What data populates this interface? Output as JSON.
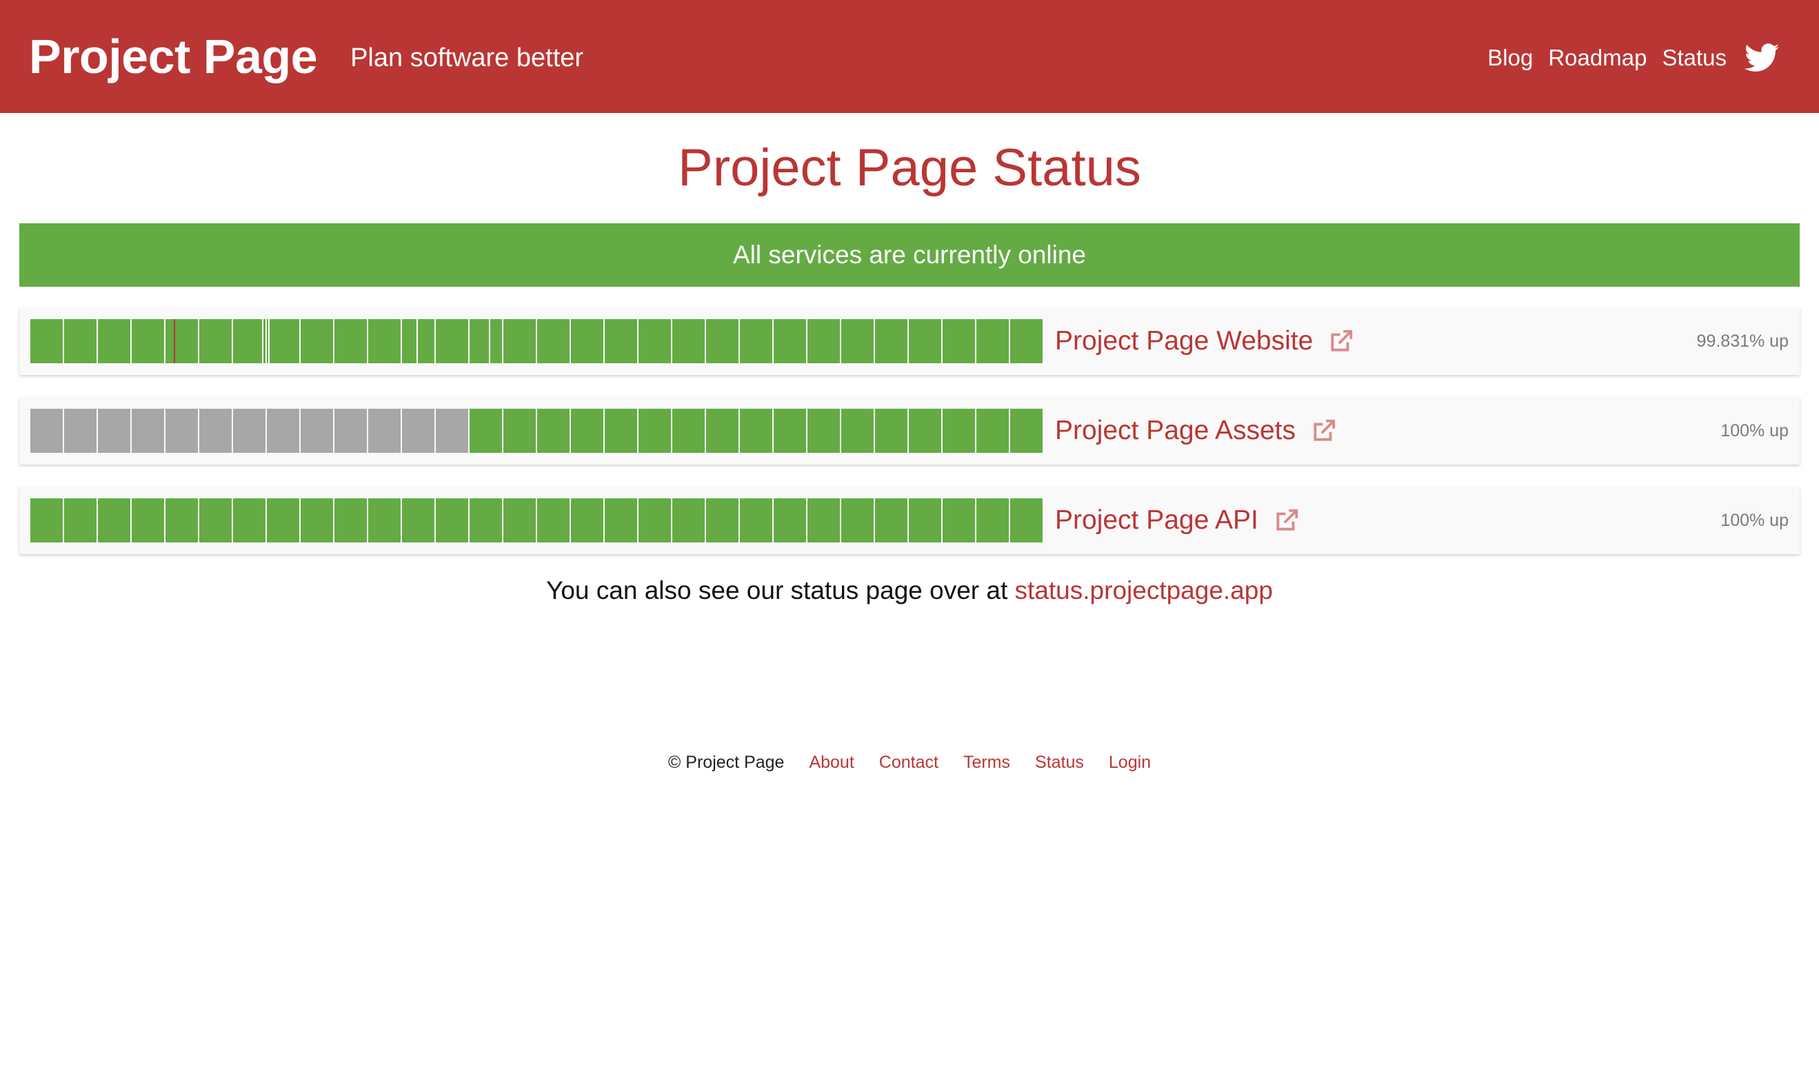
{
  "header": {
    "brand": "Project Page",
    "tagline": "Plan software better",
    "nav": [
      "Blog",
      "Roadmap",
      "Status"
    ],
    "twitter_icon": "twitter-icon",
    "background_color": "#b93634"
  },
  "page_title": "Project Page Status",
  "banner": {
    "text": "All services are currently online",
    "color": "#64ab44"
  },
  "services": [
    {
      "name": "Project Page Website",
      "uptime": "99.831% up",
      "bars": [
        "up",
        "up",
        "up",
        "up",
        "up",
        "up",
        "up",
        "up",
        "up",
        "up",
        "up",
        "up",
        "up",
        "up",
        "up",
        "up",
        "up",
        "up",
        "up",
        "up",
        "up",
        "up",
        "up",
        "up",
        "up",
        "up",
        "up",
        "up",
        "up",
        "up"
      ],
      "incident_marks": [
        {
          "bar": 4,
          "at": 0.25,
          "color": "#b93634"
        },
        {
          "bar": 6,
          "at": 0.9,
          "color": "#ffffff"
        },
        {
          "bar": 7,
          "at": 0.05,
          "color": "#ffffff"
        },
        {
          "bar": 11,
          "at": 0.45,
          "color": "#ffffff"
        },
        {
          "bar": 13,
          "at": 0.6,
          "color": "#ffffff"
        }
      ]
    },
    {
      "name": "Project Page Assets",
      "uptime": "100% up",
      "bars": [
        "none",
        "none",
        "none",
        "none",
        "none",
        "none",
        "none",
        "none",
        "none",
        "none",
        "none",
        "none",
        "none",
        "up",
        "up",
        "up",
        "up",
        "up",
        "up",
        "up",
        "up",
        "up",
        "up",
        "up",
        "up",
        "up",
        "up",
        "up",
        "up",
        "up"
      ],
      "incident_marks": []
    },
    {
      "name": "Project Page API",
      "uptime": "100% up",
      "bars": [
        "up",
        "up",
        "up",
        "up",
        "up",
        "up",
        "up",
        "up",
        "up",
        "up",
        "up",
        "up",
        "up",
        "up",
        "up",
        "up",
        "up",
        "up",
        "up",
        "up",
        "up",
        "up",
        "up",
        "up",
        "up",
        "up",
        "up",
        "up",
        "up",
        "up"
      ],
      "incident_marks": []
    }
  ],
  "external_link_icon": "external-link-icon",
  "colors": {
    "up": "#64ab44",
    "none": "#a7a7a7",
    "accent": "#b93634"
  },
  "note": {
    "text": "You can also see our status page over at ",
    "link": "status.projectpage.app"
  },
  "footer": {
    "copyright": "© Project Page",
    "links": [
      "About",
      "Contact",
      "Terms",
      "Status",
      "Login"
    ]
  }
}
